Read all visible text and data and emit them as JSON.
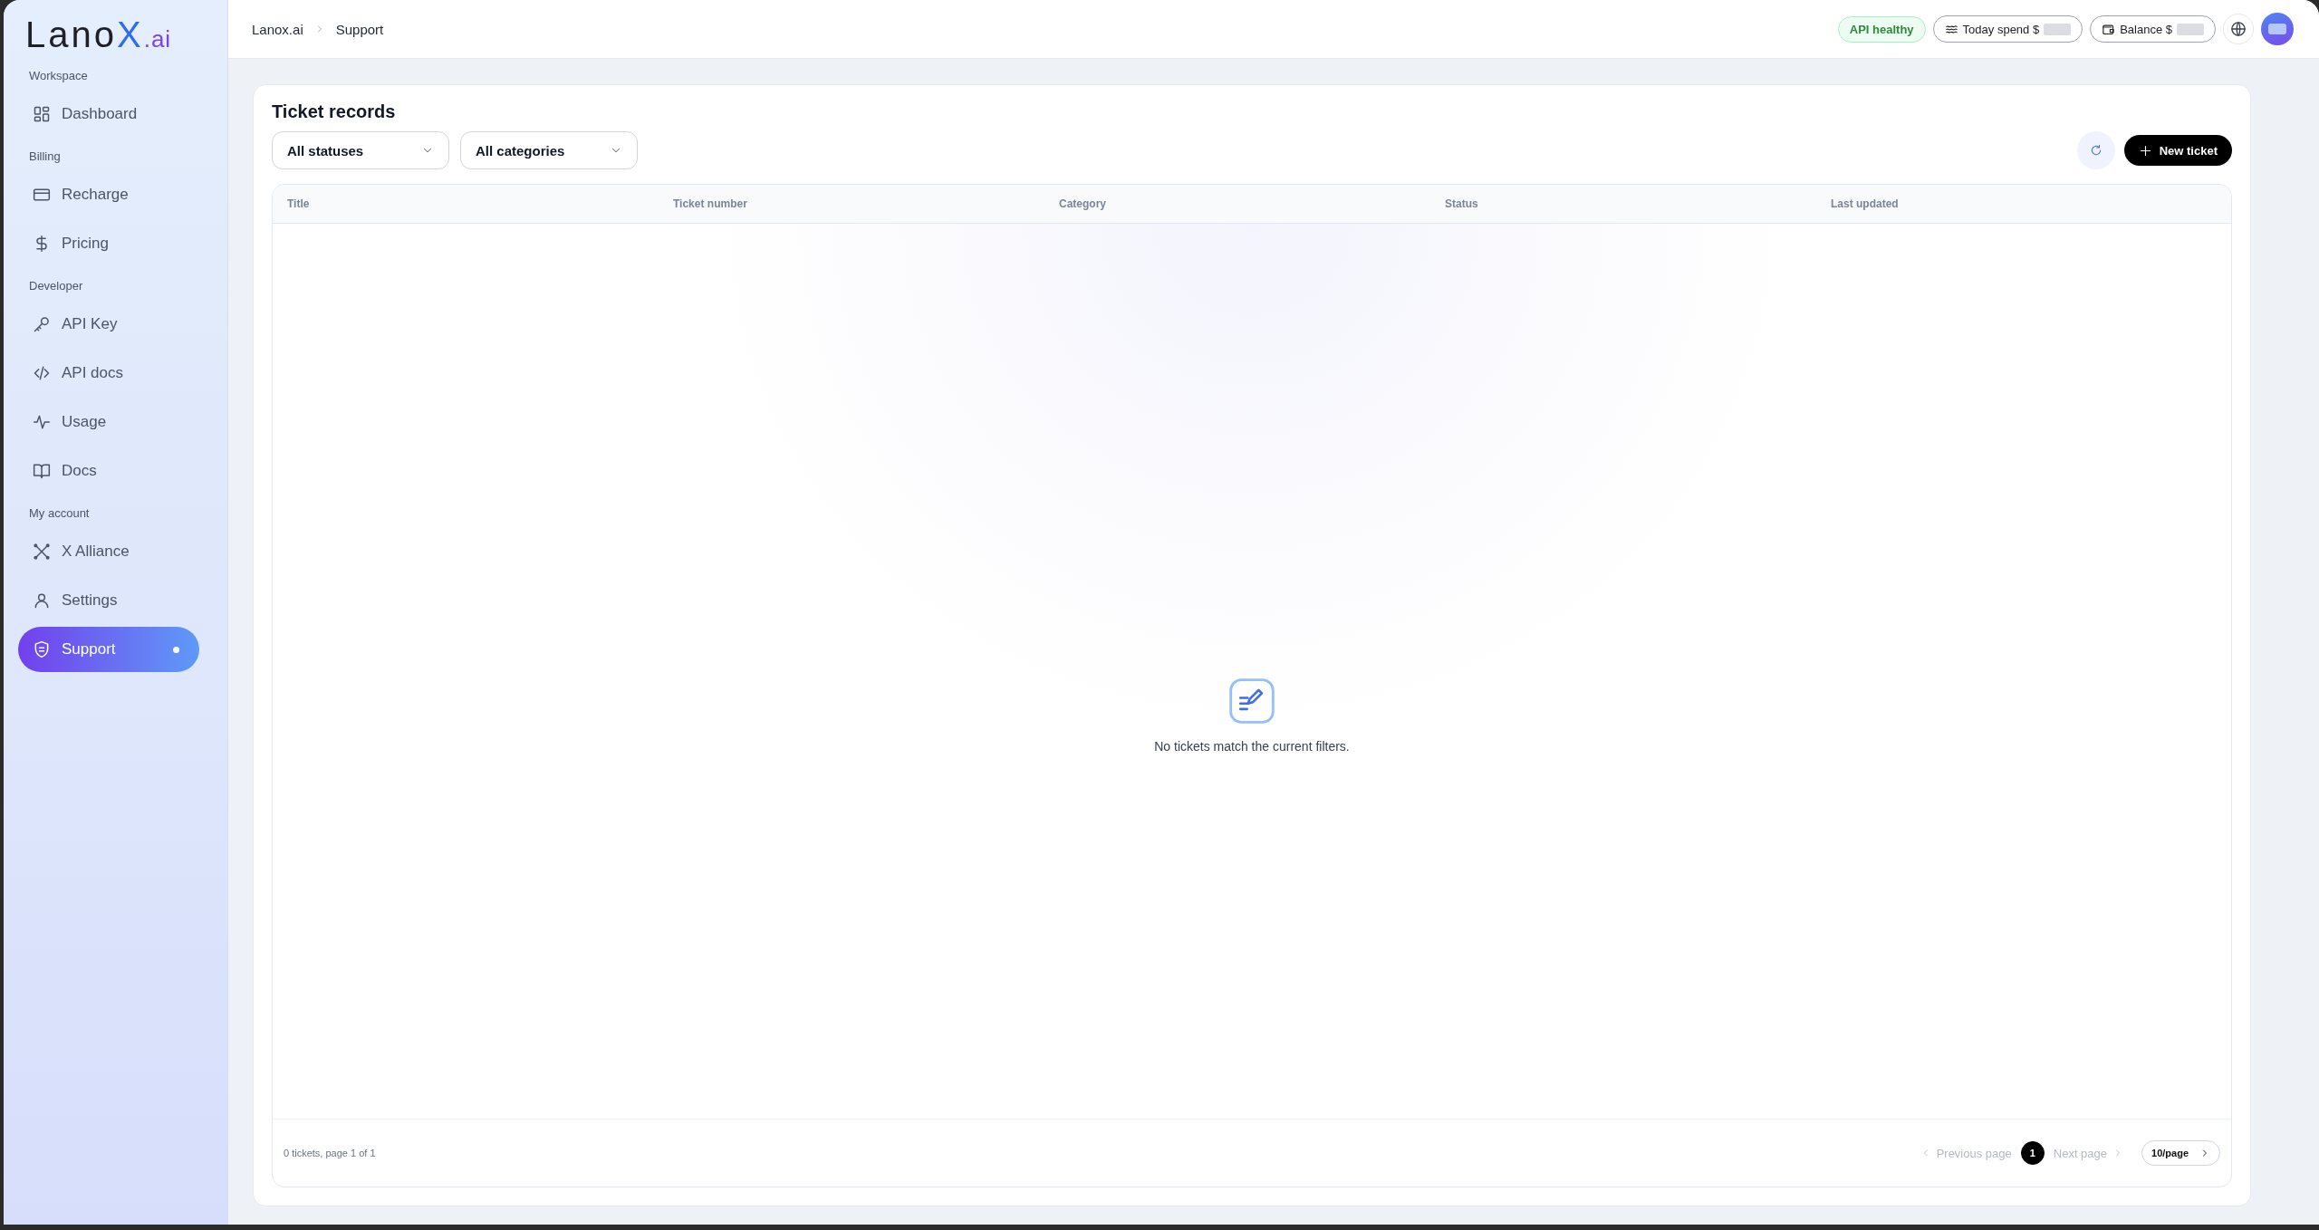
{
  "logo": {
    "word": "Lano",
    "mark": "X",
    "suffix": ".ai"
  },
  "sidebar": {
    "sections": [
      {
        "label": "Workspace",
        "items": [
          {
            "label": "Dashboard",
            "selected": false
          }
        ]
      },
      {
        "label": "Billing",
        "items": [
          {
            "label": "Recharge",
            "selected": false
          },
          {
            "label": "Pricing",
            "selected": false
          }
        ]
      },
      {
        "label": "Developer",
        "items": [
          {
            "label": "API Key",
            "selected": false
          },
          {
            "label": "API docs",
            "selected": false
          },
          {
            "label": "Usage",
            "selected": false
          },
          {
            "label": "Docs",
            "selected": false
          }
        ]
      },
      {
        "label": "My account",
        "items": [
          {
            "label": "X Alliance",
            "selected": false
          },
          {
            "label": "Settings",
            "selected": false
          },
          {
            "label": "Support",
            "selected": true
          }
        ]
      }
    ]
  },
  "breadcrumb": [
    "Lanox.ai",
    "Support"
  ],
  "header": {
    "status": "API healthy",
    "today_spend": {
      "label": "Today spend $",
      "redacted": true
    },
    "balance": {
      "label": "Balance $",
      "redacted": true
    }
  },
  "card": {
    "title": "Ticket records",
    "filters": [
      {
        "label": "All statuses"
      },
      {
        "label": "All categories"
      }
    ],
    "new_button": "New ticket",
    "table": {
      "columns": [
        "Title",
        "Ticket number",
        "Category",
        "Status",
        "Last updated"
      ],
      "empty_message": "No tickets match the current filters."
    },
    "footer": {
      "summary": "0 tickets, page 1 of 1",
      "previous": {
        "label": "Previous page",
        "disabled": true
      },
      "pages": [
        {
          "label": "1",
          "selected": true
        }
      ],
      "next": {
        "label": "Next page",
        "disabled": true
      },
      "page_size": "10/page"
    }
  }
}
